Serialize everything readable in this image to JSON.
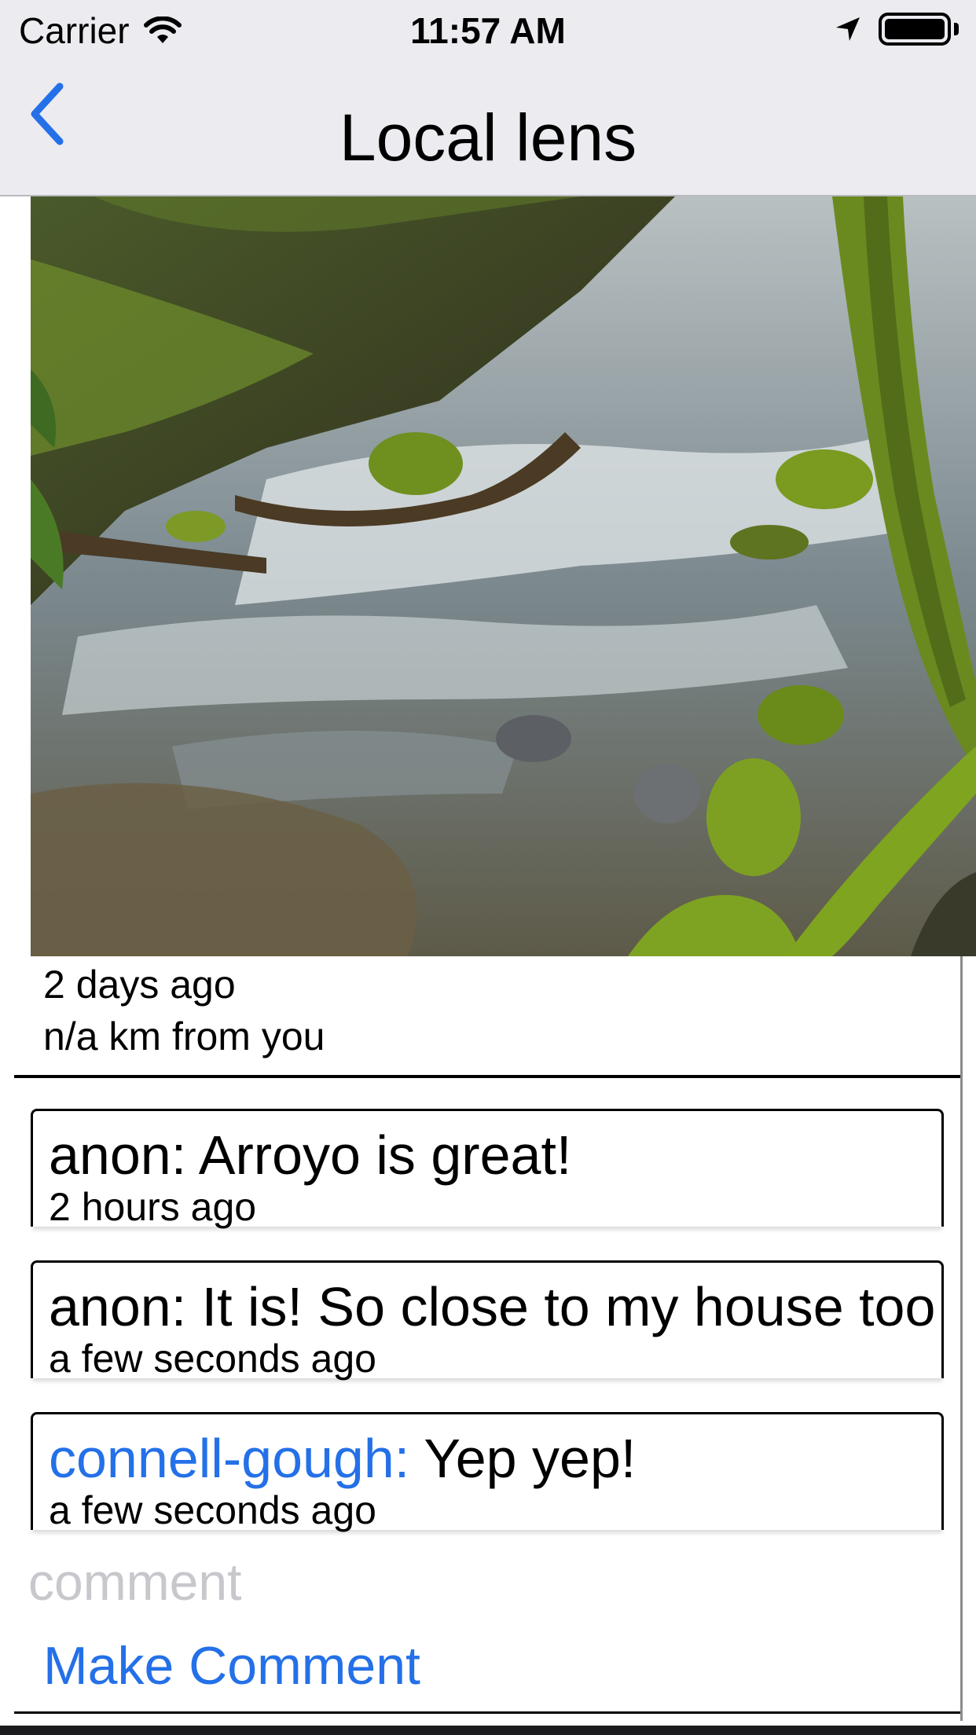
{
  "status_bar": {
    "carrier": "Carrier",
    "time": "11:57 AM"
  },
  "nav": {
    "title": "Local lens"
  },
  "post": {
    "age": "2 days ago",
    "distance": "n/a km from you"
  },
  "comments": [
    {
      "author": "anon:",
      "text": " Arroyo is great!",
      "time": "2 hours ago",
      "author_is_link": false
    },
    {
      "author": "anon:",
      "text": " It is! So close to my house too",
      "time": "a few seconds ago",
      "author_is_link": false
    },
    {
      "author": "connell-gough:",
      "text": " Yep yep!",
      "time": "a few seconds ago",
      "author_is_link": true
    }
  ],
  "comment_input": {
    "placeholder": "comment",
    "value": ""
  },
  "actions": {
    "make_comment_label": "Make Comment"
  },
  "colors": {
    "accent_blue": "#2470e8",
    "nav_background": "#ebebf0",
    "placeholder_gray": "#c7c7cc"
  }
}
